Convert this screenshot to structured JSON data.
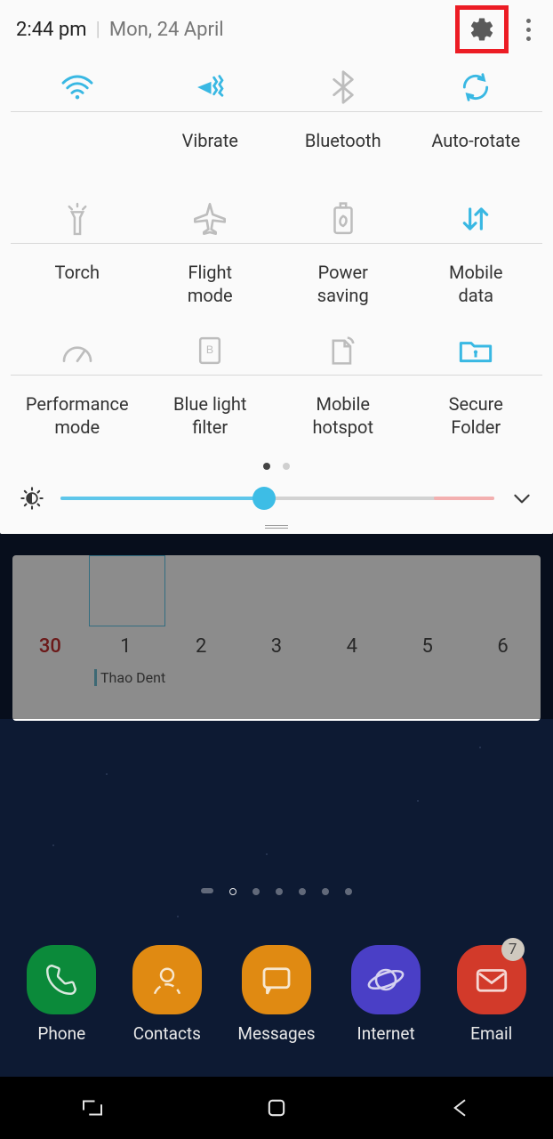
{
  "status": {
    "time": "2:44 pm",
    "date": "Mon, 24 April"
  },
  "toggles": [
    {
      "id": "wifi",
      "label": " ",
      "active": true
    },
    {
      "id": "vibrate",
      "label": "Vibrate",
      "active": true
    },
    {
      "id": "bluetooth",
      "label": "Bluetooth",
      "active": false
    },
    {
      "id": "autorotate",
      "label": "Auto-rotate",
      "active": true
    },
    {
      "id": "torch",
      "label": "Torch",
      "active": false
    },
    {
      "id": "flightmode",
      "label": "Flight\nmode",
      "active": false
    },
    {
      "id": "powersaving",
      "label": "Power\nsaving",
      "active": false
    },
    {
      "id": "mobiledata",
      "label": "Mobile\ndata",
      "active": true
    },
    {
      "id": "performance",
      "label": "Performance\nmode",
      "active": false
    },
    {
      "id": "bluelight",
      "label": "Blue light\nfilter",
      "active": false
    },
    {
      "id": "hotspot",
      "label": "Mobile\nhotspot",
      "active": false
    },
    {
      "id": "securefolder",
      "label": "Secure\nFolder",
      "active": true
    }
  ],
  "brightness": {
    "percent": 47
  },
  "calendar": {
    "days": [
      "30",
      "1",
      "2",
      "3",
      "4",
      "5",
      "6"
    ],
    "event": "Thao Dent",
    "selected_index": 1
  },
  "dock": [
    {
      "id": "phone",
      "label": "Phone",
      "color": "#0b8a3a"
    },
    {
      "id": "contacts",
      "label": "Contacts",
      "color": "#e08a12"
    },
    {
      "id": "messages",
      "label": "Messages",
      "color": "#e08a12"
    },
    {
      "id": "internet",
      "label": "Internet",
      "color": "#4a3fc6"
    },
    {
      "id": "email",
      "label": "Email",
      "color": "#d23a2a",
      "badge": "7"
    }
  ],
  "colors": {
    "accent": "#39b8e3",
    "inactive": "#bdbdbd"
  }
}
